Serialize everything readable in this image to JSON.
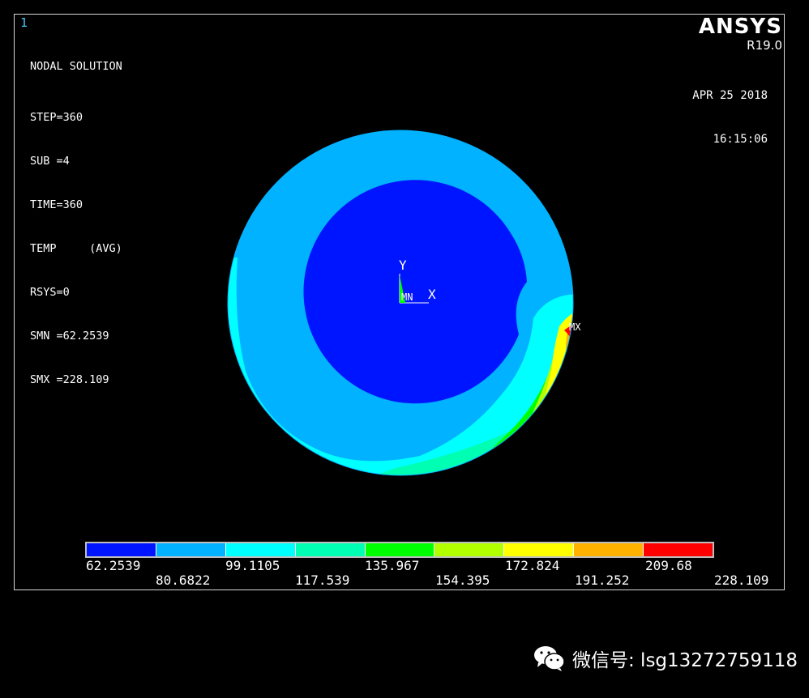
{
  "window_number": "1",
  "info": {
    "title": "NODAL SOLUTION",
    "lines": [
      "STEP=360",
      "SUB =4",
      "TIME=360",
      "TEMP     (AVG)",
      "RSYS=0",
      "SMN =62.2539",
      "SMX =228.109"
    ]
  },
  "brand": {
    "name": "ANSYS",
    "version": "R19.0"
  },
  "date": "APR 25 2018",
  "time": "16:15:06",
  "triad": {
    "y_label": "Y",
    "x_label": "X",
    "mn_label": "MN"
  },
  "mx_label": "MX",
  "legend": {
    "colors": [
      "#0015ff",
      "#00b2ff",
      "#00ffff",
      "#00ffb3",
      "#00ff00",
      "#b2ff00",
      "#ffff00",
      "#ffb200",
      "#ff0000"
    ],
    "upper_ticks": [
      "62.2539",
      "99.1105",
      "135.967",
      "172.824",
      "209.68"
    ],
    "lower_ticks": [
      "80.6822",
      "117.539",
      "154.395",
      "191.252",
      "228.109"
    ]
  },
  "watermark": "微信号: lsg13272759118"
}
